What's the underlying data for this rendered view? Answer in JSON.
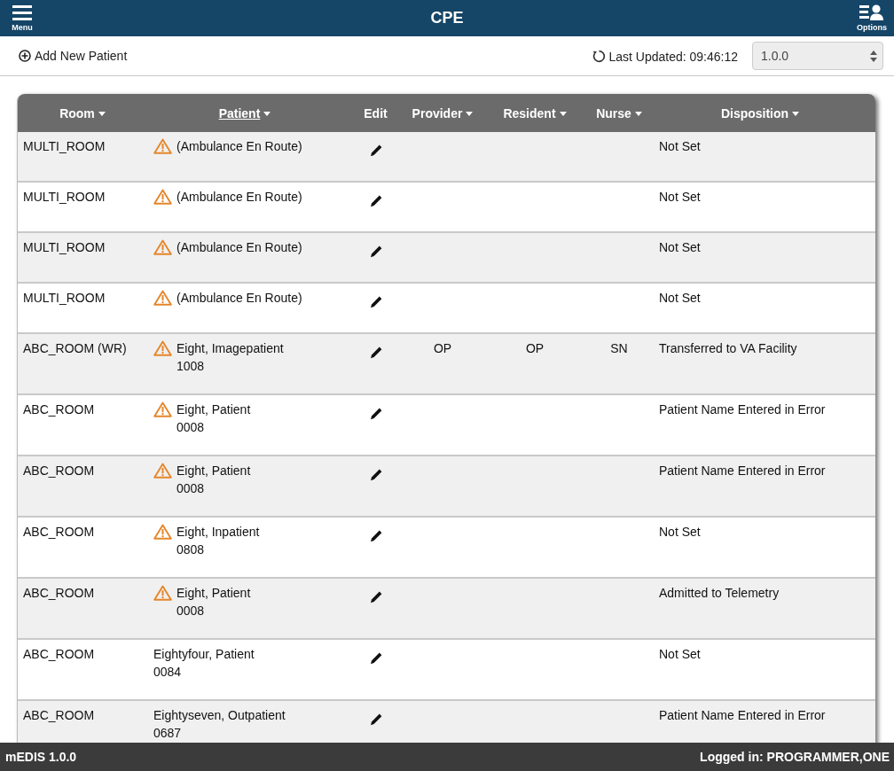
{
  "top_bar": {
    "menu_label": "Menu",
    "title": "CPE",
    "options_label": "Options"
  },
  "toolbar": {
    "add_patient": "Add New Patient",
    "last_updated": "Last Updated: 09:46:12",
    "version_select": {
      "value": "1.0.0"
    }
  },
  "table": {
    "columns": [
      {
        "label": "Room",
        "sortable": true,
        "selected": false
      },
      {
        "label": "Patient",
        "sortable": true,
        "selected": true
      },
      {
        "label": "Edit",
        "sortable": false,
        "selected": false
      },
      {
        "label": "Provider",
        "sortable": true,
        "selected": false
      },
      {
        "label": "Resident",
        "sortable": true,
        "selected": false
      },
      {
        "label": "Nurse",
        "sortable": true,
        "selected": false
      },
      {
        "label": "Disposition",
        "sortable": true,
        "selected": false
      }
    ],
    "rows": [
      {
        "room": "MULTI_ROOM",
        "warning": true,
        "patient": "(Ambulance En Route)",
        "disposition": "Not Set"
      },
      {
        "room": "MULTI_ROOM",
        "warning": true,
        "patient": "(Ambulance En Route)",
        "disposition": "Not Set"
      },
      {
        "room": "MULTI_ROOM",
        "warning": true,
        "patient": "(Ambulance En Route)",
        "disposition": "Not Set"
      },
      {
        "room": "MULTI_ROOM",
        "warning": true,
        "patient": "(Ambulance En Route)",
        "disposition": "Not Set"
      },
      {
        "room": "ABC_ROOM (WR)",
        "warning": true,
        "patient": "Eight, Imagepatient",
        "patient_id": "1008",
        "provider": "OP",
        "resident": "OP",
        "nurse": "SN",
        "disposition": "Transferred to VA Facility"
      },
      {
        "room": "ABC_ROOM",
        "warning": true,
        "patient": "Eight, Patient",
        "patient_id": "0008",
        "disposition": "Patient Name Entered in Error"
      },
      {
        "room": "ABC_ROOM",
        "warning": true,
        "patient": "Eight, Patient",
        "patient_id": "0008",
        "disposition": "Patient Name Entered in Error"
      },
      {
        "room": "ABC_ROOM",
        "warning": true,
        "patient": "Eight, Inpatient",
        "patient_id": "0808",
        "disposition": "Not Set"
      },
      {
        "room": "ABC_ROOM",
        "warning": true,
        "patient": "Eight, Patient",
        "patient_id": "0008",
        "disposition": "Admitted to Telemetry"
      },
      {
        "room": "ABC_ROOM",
        "warning": false,
        "patient": "Eightyfour, Patient",
        "patient_id": "0084",
        "disposition": "Not Set"
      },
      {
        "room": "ABC_ROOM",
        "warning": false,
        "patient": "Eightyseven, Outpatient",
        "patient_id": "0687",
        "disposition": "Patient Name Entered in Error"
      }
    ]
  },
  "footer": {
    "app_version": "mEDIS 1.0.0",
    "logged_in": "Logged in: PROGRAMMER,ONE"
  }
}
